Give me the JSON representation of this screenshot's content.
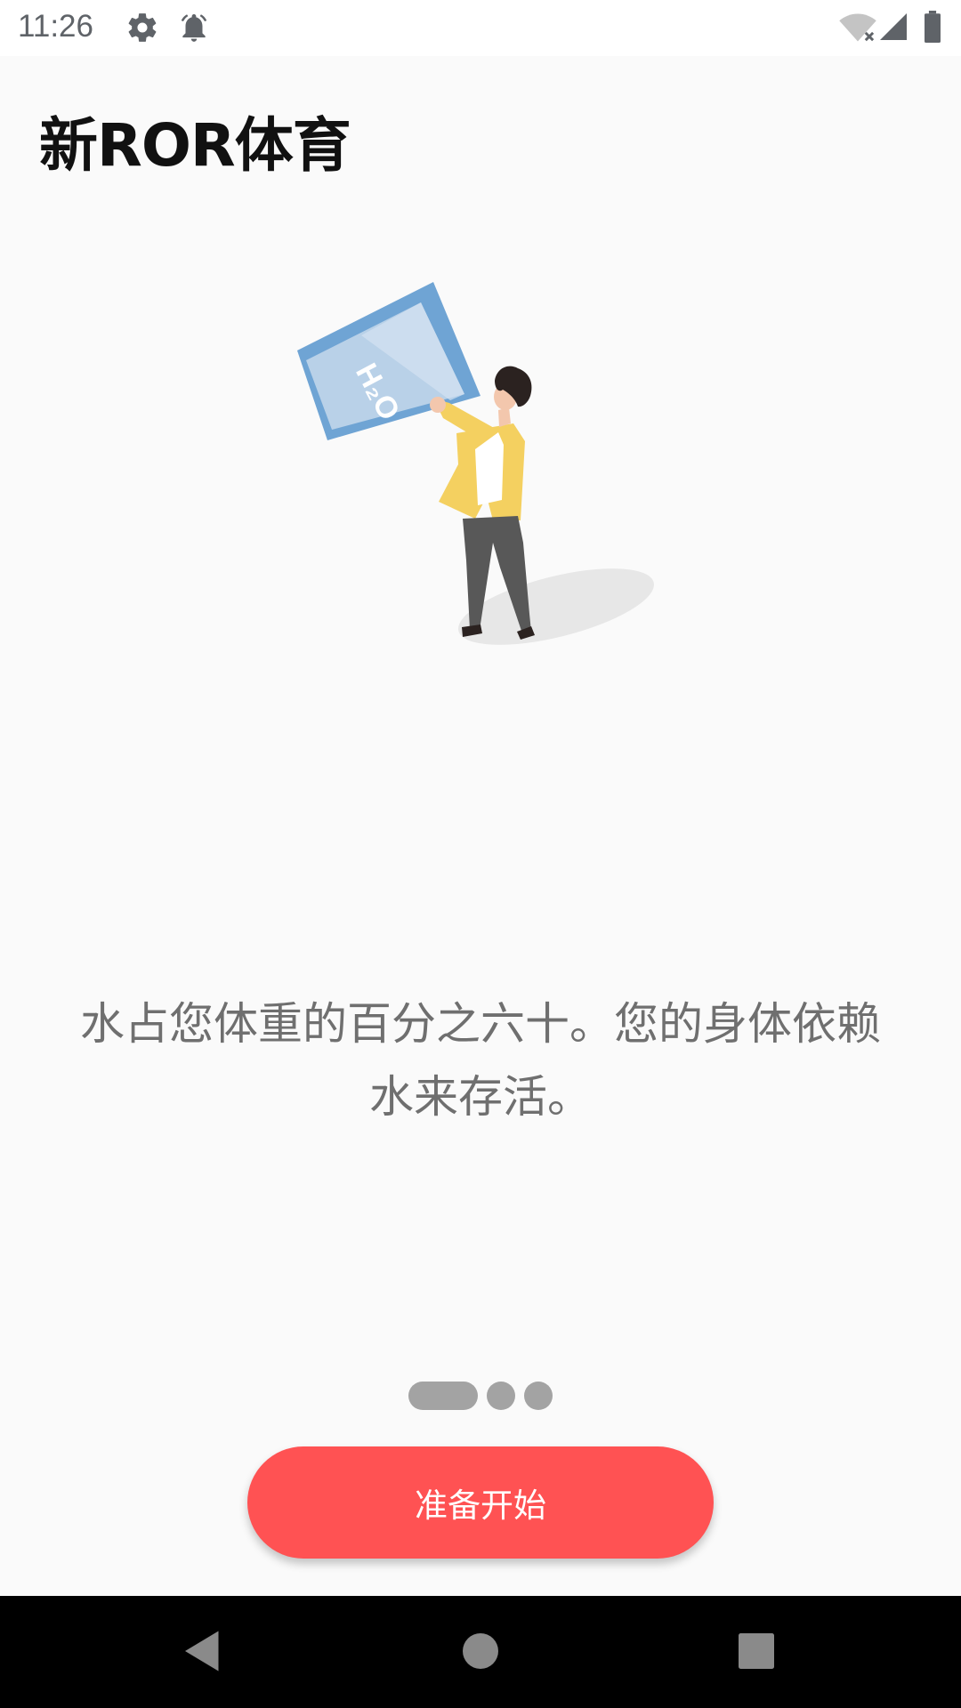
{
  "status_bar": {
    "time": "11:26",
    "icons": [
      "settings-icon",
      "alarm-icon",
      "wifi-icon",
      "signal-icon",
      "battery-icon"
    ]
  },
  "app": {
    "title": "新ROR体育"
  },
  "illustration": {
    "cup_label": "H2O"
  },
  "onboarding": {
    "message": "水占您体重的百分之六十。您的身体依赖水来存活。",
    "page_count": 3,
    "current_page": 1
  },
  "actions": {
    "start_label": "准备开始"
  },
  "nav_bar": {
    "icons": [
      "back-icon",
      "home-icon",
      "recents-icon"
    ]
  },
  "colors": {
    "accent": "#ff5253",
    "background": "#fafafa",
    "cup_blue": "#6fa4d4",
    "shirt_yellow": "#f4d060"
  }
}
